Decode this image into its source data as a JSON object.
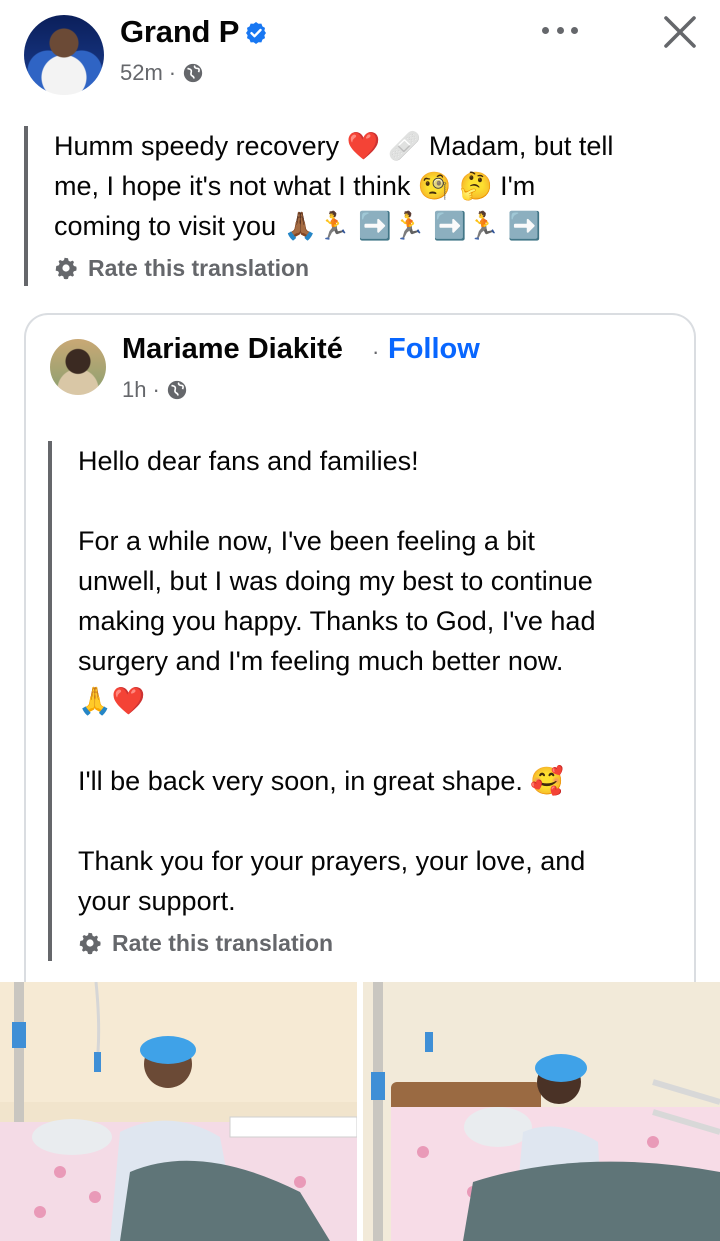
{
  "post": {
    "author": "Grand P",
    "time": "52m",
    "dot": "·",
    "text_lines": [
      "Humm speedy recovery ❤️ 🩹 Madam, but tell",
      "me, I hope it's not what I think 🧐 🤔 I'm",
      "coming to visit you 🙏🏾🏃 ➡️🏃 ➡️🏃 ➡️"
    ],
    "rate_translation": "Rate this translation"
  },
  "shared": {
    "author": "Mariame Diakité",
    "dot": "·",
    "follow_label": "Follow",
    "time": "1h",
    "paragraphs": [
      "Hello dear fans and families!",
      "",
      "For a while now, I've been feeling a bit",
      "unwell, but I was doing my best to continue",
      "making you happy. Thanks to God, I've had",
      "surgery and I'm feeling much better now.",
      "🙏❤️",
      "",
      "I'll be back very soon, in great shape. 🥰",
      "",
      "Thank you for your prayers, your love, and",
      "your support."
    ],
    "rate_translation": "Rate this translation"
  },
  "icons": {
    "verified": "verified-badge-icon",
    "globe": "globe-icon",
    "more": "more-options-icon",
    "close": "close-icon",
    "gear": "gear-icon"
  },
  "colors": {
    "text": "#050505",
    "secondary": "#65676b",
    "link": "#0866ff",
    "verified": "#1877f2",
    "border": "#dadde1"
  }
}
